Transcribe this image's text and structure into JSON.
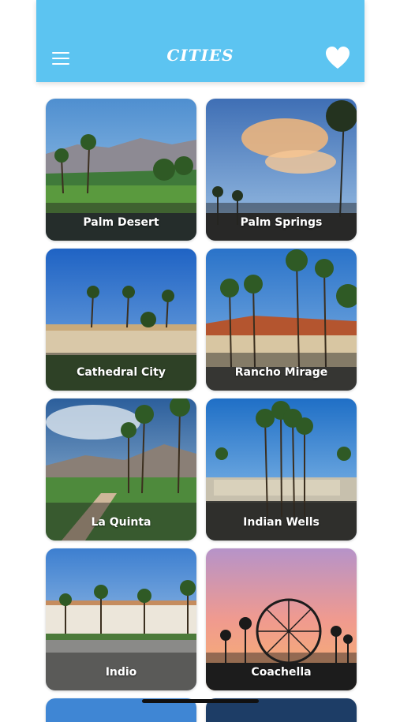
{
  "header": {
    "title": "CITIES",
    "menu_icon": "hamburger-menu-icon",
    "favorites_icon": "heart-icon",
    "bg_color": "#5cc4f1"
  },
  "cities": [
    {
      "name": "Palm Desert"
    },
    {
      "name": "Palm Springs"
    },
    {
      "name": "Cathedral City"
    },
    {
      "name": "Rancho Mirage"
    },
    {
      "name": "La Quinta"
    },
    {
      "name": "Indian Wells"
    },
    {
      "name": "Indio"
    },
    {
      "name": "Coachella"
    }
  ]
}
